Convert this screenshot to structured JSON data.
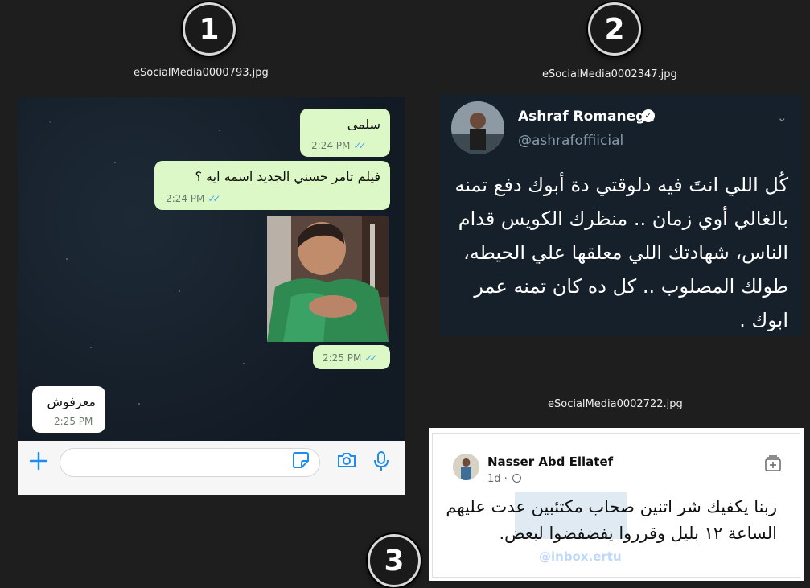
{
  "badges": {
    "b1": "1",
    "b2": "2",
    "b3": "3"
  },
  "captions": {
    "c1": "eSocialMedia0000793.jpg",
    "c2": "eSocialMedia0002347.jpg",
    "c3": "eSocialMedia0002722.jpg"
  },
  "chat": {
    "messages": [
      {
        "text": "سلمى",
        "time": "2:24 PM",
        "direction": "outgoing",
        "read_ticks": "✓✓"
      },
      {
        "text": "فيلم تامر حسني الجديد اسمه ايه ؟",
        "time": "2:24 PM",
        "direction": "outgoing",
        "read_ticks": "✓✓"
      },
      {
        "text": "",
        "time": "2:25 PM",
        "direction": "outgoing",
        "read_ticks": "✓✓",
        "attachment": "photo"
      },
      {
        "text": "معرفوش",
        "time": "2:25 PM",
        "direction": "incoming"
      }
    ],
    "input_placeholder": "",
    "icons": [
      "plus-icon",
      "sticker-icon",
      "camera-icon",
      "microphone-icon"
    ],
    "colors": {
      "outgoing_bubble": "#dcf8c6",
      "incoming_bubble": "#ffffff",
      "accent": "#1f8cea"
    }
  },
  "tweet": {
    "name": "Ashraf Romanega",
    "handle": "@ashrafoffiicial",
    "body": "كُل اللي انتَ فيه دلوقتي دة أبوك دفع تمنه بالغالي أوي زمان .. منظرك الكويس قدام الناس، شهادتك اللي معلقها علي الحيطه، طولك المصلوب .. كل ده كان تمنه عمر ابوك .",
    "verified_icon": "verified-badge-icon",
    "menu_icon": "chevron-down-icon"
  },
  "facebook": {
    "name": "Nasser Abd Ellatef",
    "time": "1d",
    "separator": "·",
    "privacy_icon": "globe-icon",
    "body": "ربنا يكفيك شر اتنين صحاب مكتئبين عدت عليهم الساعة ١٢ بليل وقرروا يفضفضوا لبعض.",
    "watermark": "@inbox.ertu"
  }
}
